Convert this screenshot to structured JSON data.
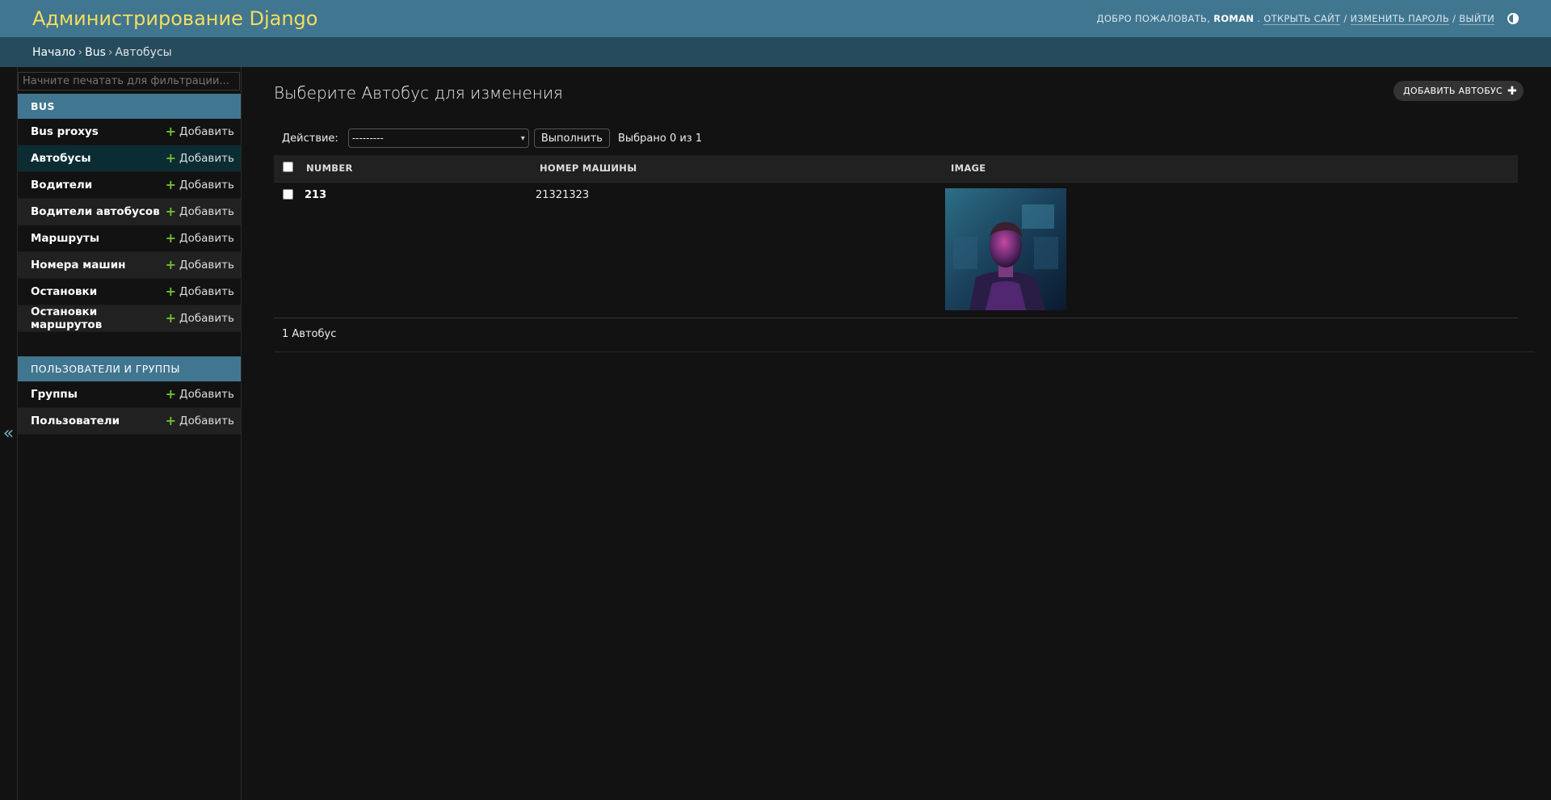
{
  "header": {
    "title": "Администрирование Django",
    "welcome": "ДОБРО ПОЖАЛОВАТЬ,",
    "username": "ROMAN",
    "view_site": "ОТКРЫТЬ САЙТ",
    "change_password": "ИЗМЕНИТЬ ПАРОЛЬ",
    "logout": "ВЫЙТИ",
    "separator": "/"
  },
  "breadcrumbs": {
    "home": "Начало",
    "app": "Bus",
    "current": "Автобусы",
    "sep": "›"
  },
  "sidebar": {
    "filter_placeholder": "Начните печатать для фильтрации...",
    "toggle": "«",
    "add_label": "Добавить",
    "modules": [
      {
        "caption": "BUS",
        "models": [
          {
            "name": "Bus proxys"
          },
          {
            "name": "Автобусы",
            "current": true
          },
          {
            "name": "Водители"
          },
          {
            "name": "Водители автобусов"
          },
          {
            "name": "Маршруты"
          },
          {
            "name": "Номера машин"
          },
          {
            "name": "Остановки"
          },
          {
            "name": "Остановки маршрутов"
          }
        ]
      },
      {
        "caption": "ПОЛЬЗОВАТЕЛИ И ГРУППЫ",
        "models": [
          {
            "name": "Группы"
          },
          {
            "name": "Пользователи"
          }
        ]
      }
    ]
  },
  "content": {
    "title": "Выберите Автобус для изменения",
    "add_button": "ДОБАВИТЬ АВТОБУС",
    "actions": {
      "label": "Действие:",
      "selected_option": "---------",
      "run_button": "Выполнить",
      "counter": "Выбрано 0 из 1"
    },
    "table": {
      "columns": [
        "NUMBER",
        "НОМЕР МАШИНЫ",
        "IMAGE"
      ],
      "rows": [
        {
          "number": "213",
          "plate": "21321323",
          "image": "photo of a man in neon light"
        }
      ]
    },
    "paginator": "1 Автобус"
  },
  "colors": {
    "header_bg": "#417690",
    "branding": "#f5dd5d",
    "breadcrumbs_bg": "#264b5d",
    "body_bg": "#121212",
    "add_plus": "#70bf2b"
  }
}
